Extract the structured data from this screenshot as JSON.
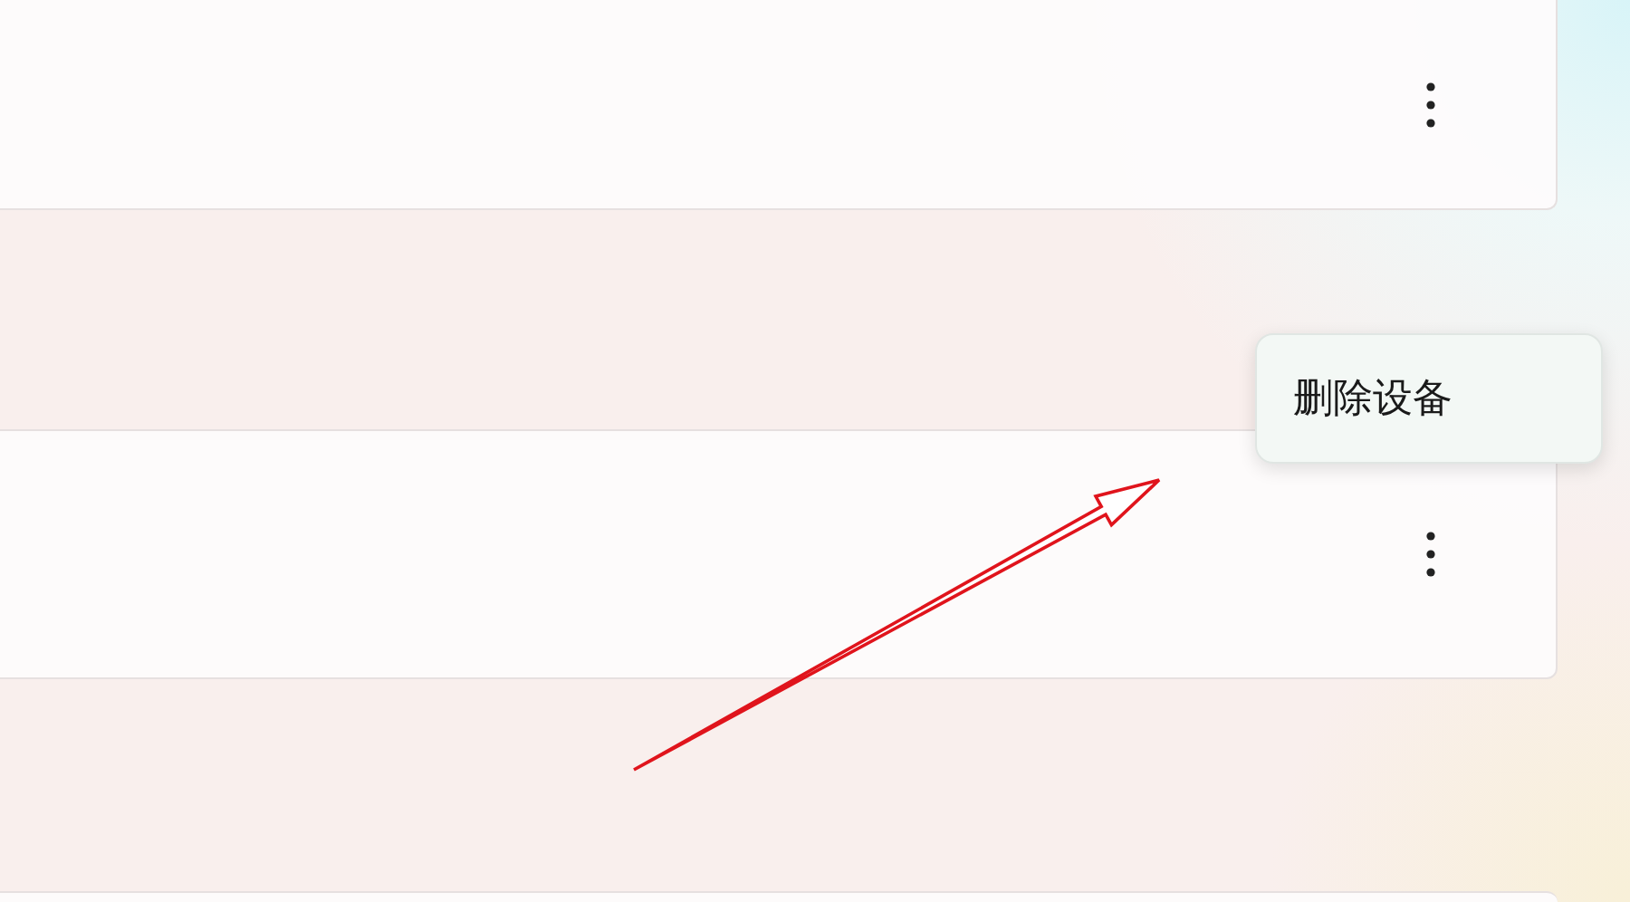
{
  "cards": [
    {
      "kind": "full"
    },
    {
      "kind": "full"
    },
    {
      "kind": "edge"
    }
  ],
  "context_menu": {
    "items": [
      {
        "label": "删除设备"
      }
    ]
  },
  "annotation": {
    "kind": "arrow"
  }
}
